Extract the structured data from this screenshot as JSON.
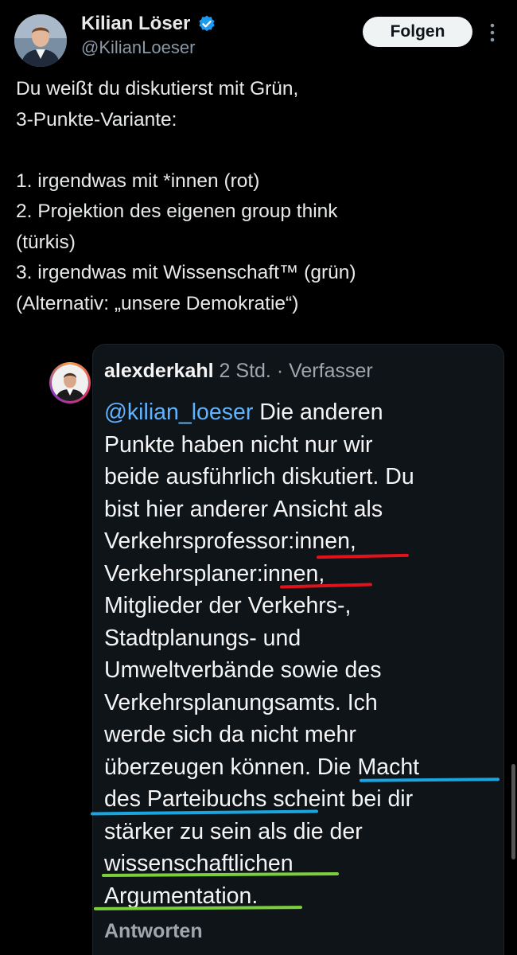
{
  "post": {
    "author_name": "Kilian Löser",
    "author_handle": "@KilianLoeser",
    "follow_label": "Folgen",
    "text": "Du weißt du diskutierst mit Grün,\n3-Punkte-Variante:\n\n1. irgendwas mit *innen (rot)\n2. Projektion des eigenen group think\n(türkis)\n3. irgendwas mit Wissenschaft™ (grün)\n(Alternativ: „unsere Demokratie“)"
  },
  "quote": {
    "username": "alexderkahl",
    "time": "2 Std.",
    "separator": "·",
    "role": "Verfasser",
    "mention": "@kilian_loeser",
    "text": " Die anderen\nPunkte haben nicht nur wir\nbeide ausführlich diskutiert. Du\nbist hier anderer Ansicht als\nVerkehrsprofessor:innen,\nVerkehrsplaner:innen,\nMitglieder der Verkehrs-,\nStadtplanungs- und\nUmweltverbände sowie des\nVerkehrsplanungsamts. Ich\nwerde sich da nicht mehr\nüberzeugen können. Die Macht\ndes Parteibuchs scheint bei dir\nstärker zu sein als die der\nwissenschaftlichen\nArgumentation.",
    "reply_label": "Antworten"
  },
  "icons": {
    "verified": "verified-badge-icon",
    "more": "more-options-icon"
  },
  "colors": {
    "background": "#000000",
    "card": "#0f1419",
    "mention": "#5fb3ff",
    "annotation_red": "#e0121b",
    "annotation_turquoise": "#18a5e0",
    "annotation_green": "#7ccf3c",
    "verified_badge": "#1d9bf0"
  }
}
